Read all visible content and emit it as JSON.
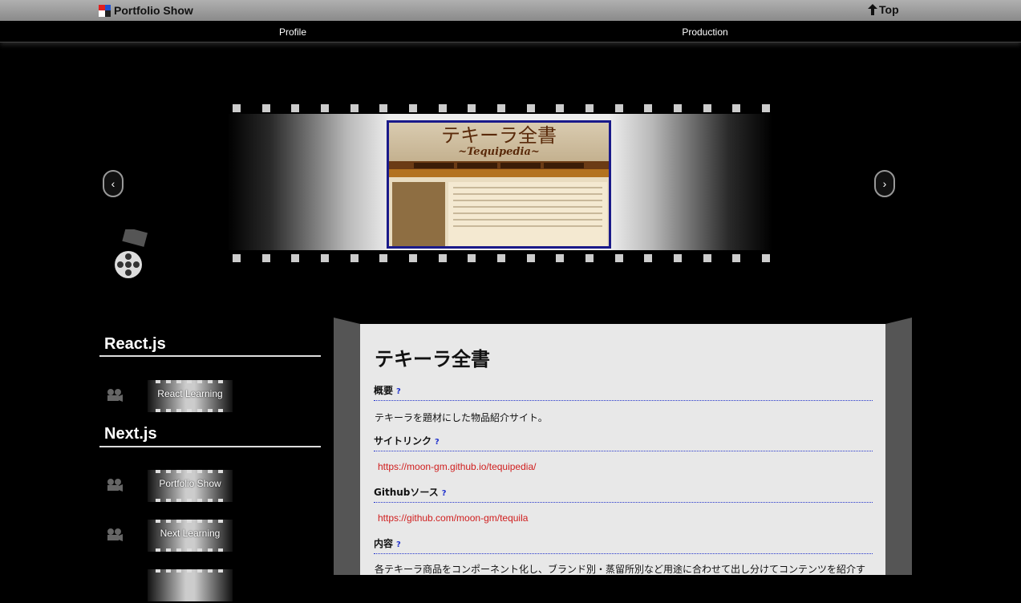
{
  "header": {
    "brand": "Portfolio Show",
    "top_link": "Top",
    "brand_colors": [
      "#e02020",
      "#2050d0",
      "#ffffff",
      "#202020"
    ]
  },
  "nav": {
    "items": [
      "Profile",
      "Production"
    ]
  },
  "carousel": {
    "prev_icon": "chevron-left-icon",
    "next_icon": "chevron-right-icon",
    "slide": {
      "title": "テキーラ全書",
      "subtitle": "~Tequipedia~"
    }
  },
  "sidebar": {
    "categories": [
      {
        "name": "React.js",
        "projects": [
          "React Learning"
        ]
      },
      {
        "name": "Next.js",
        "projects": [
          "Portfolio Show",
          "Next Learning"
        ]
      }
    ]
  },
  "detail": {
    "title": "テキーラ全書",
    "help_mark": "?",
    "sections": {
      "overview": {
        "label": "概要",
        "text": "テキーラを題材にした物品紹介サイト。"
      },
      "site_link": {
        "label": "サイトリンク",
        "url": "https://moon-gm.github.io/tequipedia/"
      },
      "github": {
        "label": "Githubソース",
        "url": "https://github.com/moon-gm/tequila"
      },
      "content": {
        "label": "内容",
        "text": "各テキーラ商品をコンポーネント化し、ブランド別・蒸留所別など用途に合わせて出し分けてコンテンツを紹介す"
      }
    }
  }
}
